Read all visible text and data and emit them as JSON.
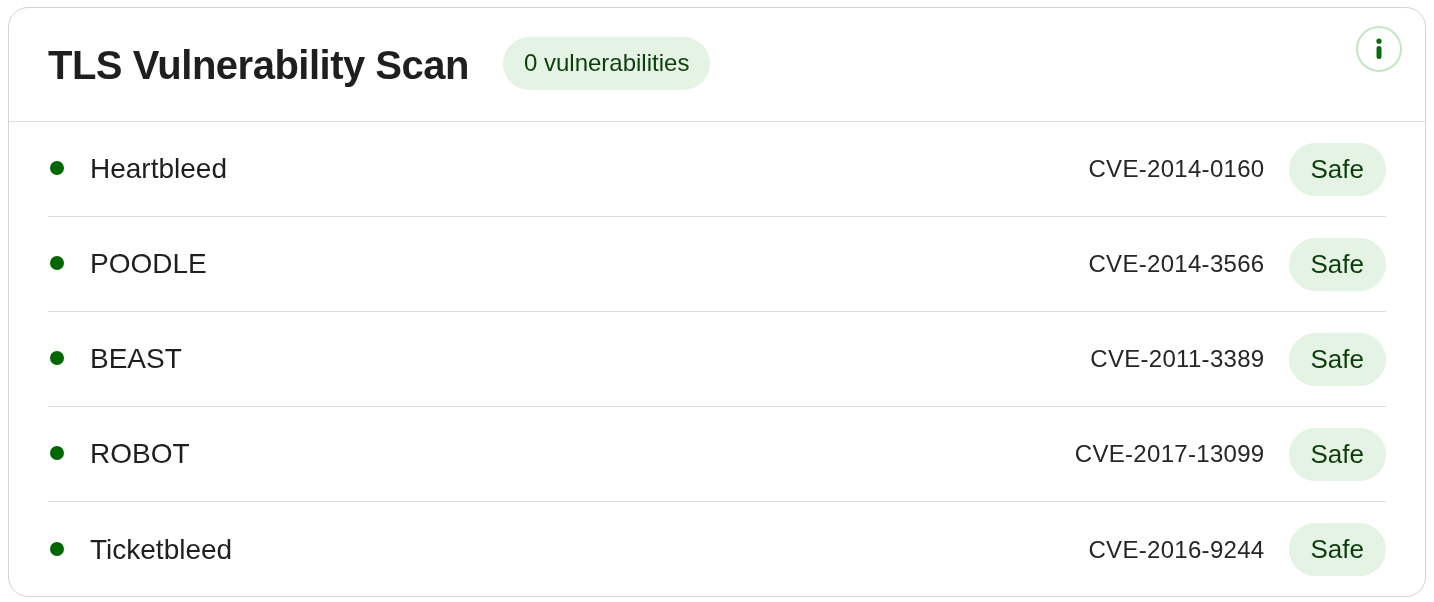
{
  "header": {
    "title": "TLS Vulnerability Scan",
    "count_badge": "0 vulnerabilities"
  },
  "vulnerabilities": [
    {
      "name": "Heartbleed",
      "cve": "CVE-2014-0160",
      "status": "Safe",
      "color": "#006600"
    },
    {
      "name": "POODLE",
      "cve": "CVE-2014-3566",
      "status": "Safe",
      "color": "#006600"
    },
    {
      "name": "BEAST",
      "cve": "CVE-2011-3389",
      "status": "Safe",
      "color": "#006600"
    },
    {
      "name": "ROBOT",
      "cve": "CVE-2017-13099",
      "status": "Safe",
      "color": "#006600"
    },
    {
      "name": "Ticketbleed",
      "cve": "CVE-2016-9244",
      "status": "Safe",
      "color": "#006600"
    }
  ]
}
